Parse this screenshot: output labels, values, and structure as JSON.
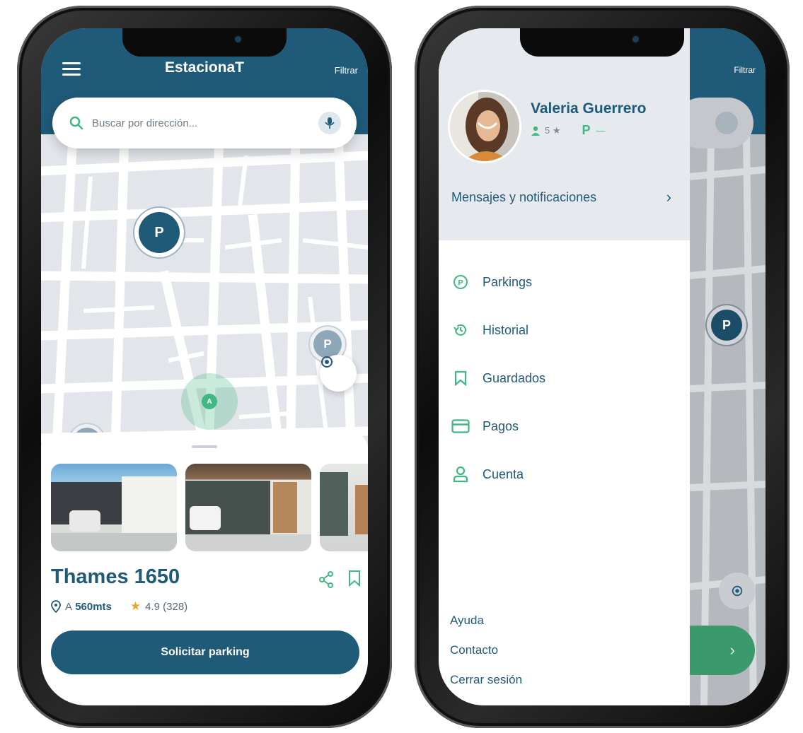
{
  "colors": {
    "primary": "#1f5a78",
    "accent": "#3fb883",
    "star": "#f0a42a",
    "map_bg": "#e2e5ea",
    "road": "#ffffff"
  },
  "left_phone": {
    "header": {
      "menu_icon": "hamburger-icon",
      "title": "EstacionaT",
      "filter_label": "Filtrar"
    },
    "search": {
      "icon": "search-icon",
      "placeholder": "Buscar por dirección...",
      "mic_icon": "mic-icon"
    },
    "map": {
      "pin_label": "P",
      "user_marker_label": "A",
      "locate_icon": "target-icon"
    },
    "sheet": {
      "photo_count": 3,
      "title": "Thames 1650",
      "distance_prefix": "A",
      "distance_value": "560mts",
      "rating": "4.9 (328)",
      "share_icon": "share-icon",
      "bookmark_icon": "bookmark-icon",
      "cta_label": "Solicitar parking"
    }
  },
  "right_phone": {
    "header": {
      "filter_label": "Filtrar"
    },
    "user": {
      "name": "Valeria Guerrero",
      "rating": "5 ★",
      "parking_badge": "P",
      "parking_value": "—"
    },
    "messages_label": "Mensajes y notificaciones",
    "menu": [
      {
        "label": "Parkings",
        "icon": "parking-icon"
      },
      {
        "label": "Historial",
        "icon": "history-icon"
      },
      {
        "label": "Guardados",
        "icon": "bookmark-icon"
      },
      {
        "label": "Pagos",
        "icon": "credit-card-icon"
      },
      {
        "label": "Cuenta",
        "icon": "user-icon"
      }
    ],
    "footer": [
      "Ayuda",
      "Contacto",
      "Cerrar sesión"
    ],
    "pin_label": "P"
  }
}
